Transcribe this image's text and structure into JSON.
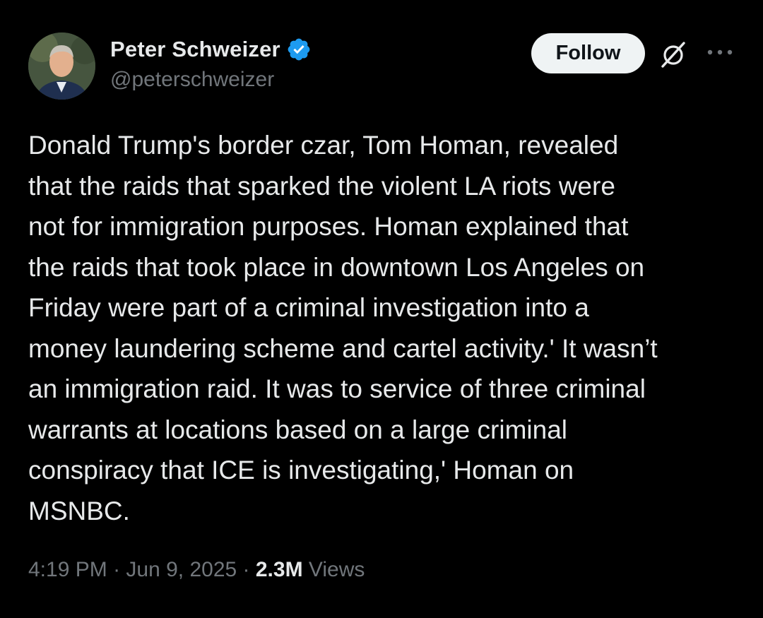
{
  "author": {
    "display_name": "Peter Schweizer",
    "handle": "@peterschweizer",
    "verified": true,
    "verified_color": "#1d9bf0"
  },
  "actions": {
    "follow_label": "Follow",
    "grok_icon": "grok-icon",
    "more_icon": "more-horizontal-icon"
  },
  "tweet": {
    "text": "Donald Trump's border czar, Tom Homan, revealed\nthat the raids that sparked the violent LA riots were\nnot for immigration purposes. Homan explained that\nthe raids that took place in downtown Los Angeles on\nFriday were part of a criminal investigation into a\nmoney laundering scheme and cartel activity.' It wasn’t\nan immigration raid. It was to service of three criminal\nwarrants at locations based on a large criminal\nconspiracy that ICE is investigating,' Homan on\nMSNBC."
  },
  "meta": {
    "time": "4:19 PM",
    "separator": " · ",
    "date": "Jun 9, 2025",
    "views_count": "2.3M",
    "views_label": " Views"
  },
  "colors": {
    "background": "#000000",
    "primary_text": "#e7e9ea",
    "secondary_text": "#71767b",
    "follow_bg": "#eff3f4"
  }
}
